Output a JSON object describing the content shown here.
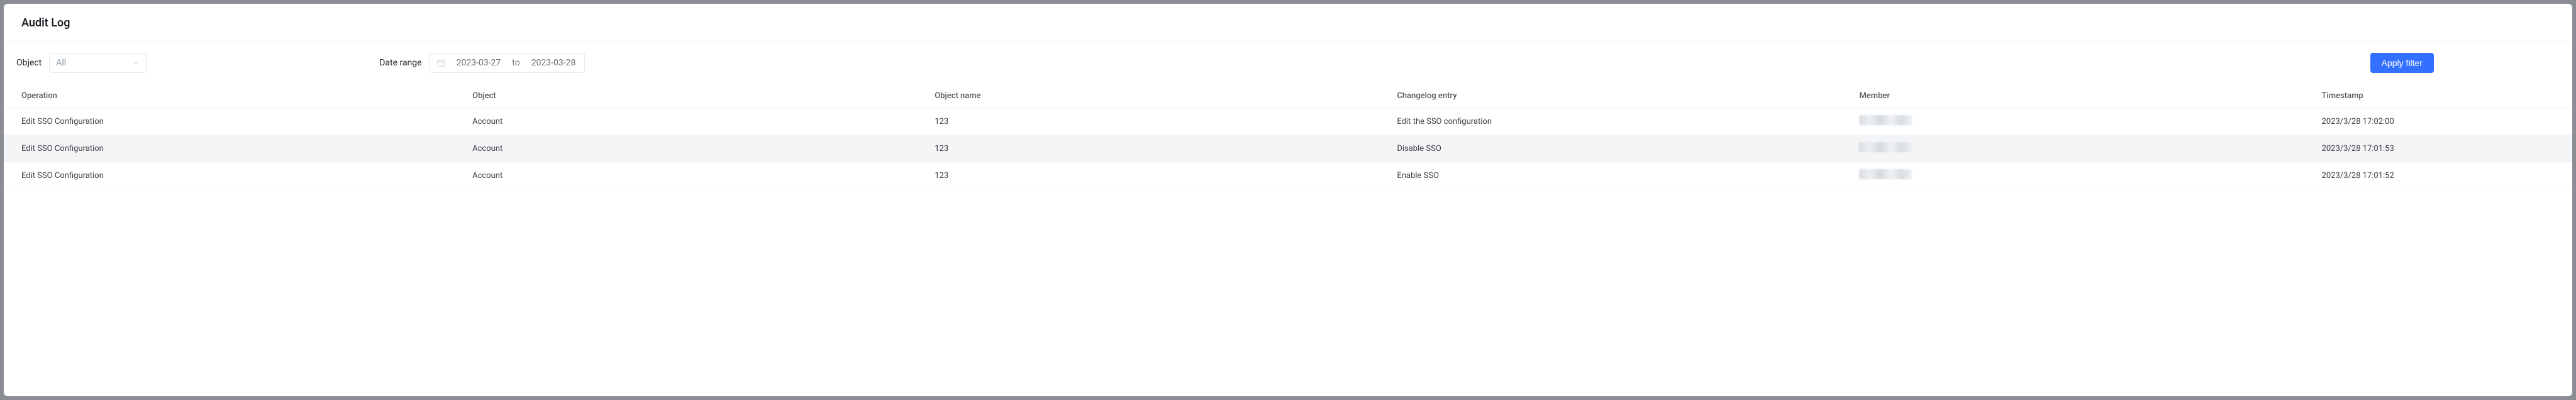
{
  "page": {
    "title": "Audit Log"
  },
  "filters": {
    "object_label": "Object",
    "object_value": "All",
    "date_label": "Date range",
    "date_from": "2023-03-27",
    "date_sep": "to",
    "date_to": "2023-03-28",
    "apply_label": "Apply filter"
  },
  "table": {
    "headers": {
      "operation": "Operation",
      "object": "Object",
      "object_name": "Object name",
      "changelog": "Changelog entry",
      "member": "Member",
      "timestamp": "Timestamp"
    },
    "rows": [
      {
        "operation": "Edit SSO Configuration",
        "object": "Account",
        "object_name": "123",
        "changelog": "Edit the SSO configuration",
        "member": "",
        "timestamp": "2023/3/28 17:02:00"
      },
      {
        "operation": "Edit SSO Configuration",
        "object": "Account",
        "object_name": "123",
        "changelog": "Disable SSO",
        "member": "",
        "timestamp": "2023/3/28 17:01:53"
      },
      {
        "operation": "Edit SSO Configuration",
        "object": "Account",
        "object_name": "123",
        "changelog": "Enable SSO",
        "member": "",
        "timestamp": "2023/3/28 17:01:52"
      }
    ]
  }
}
